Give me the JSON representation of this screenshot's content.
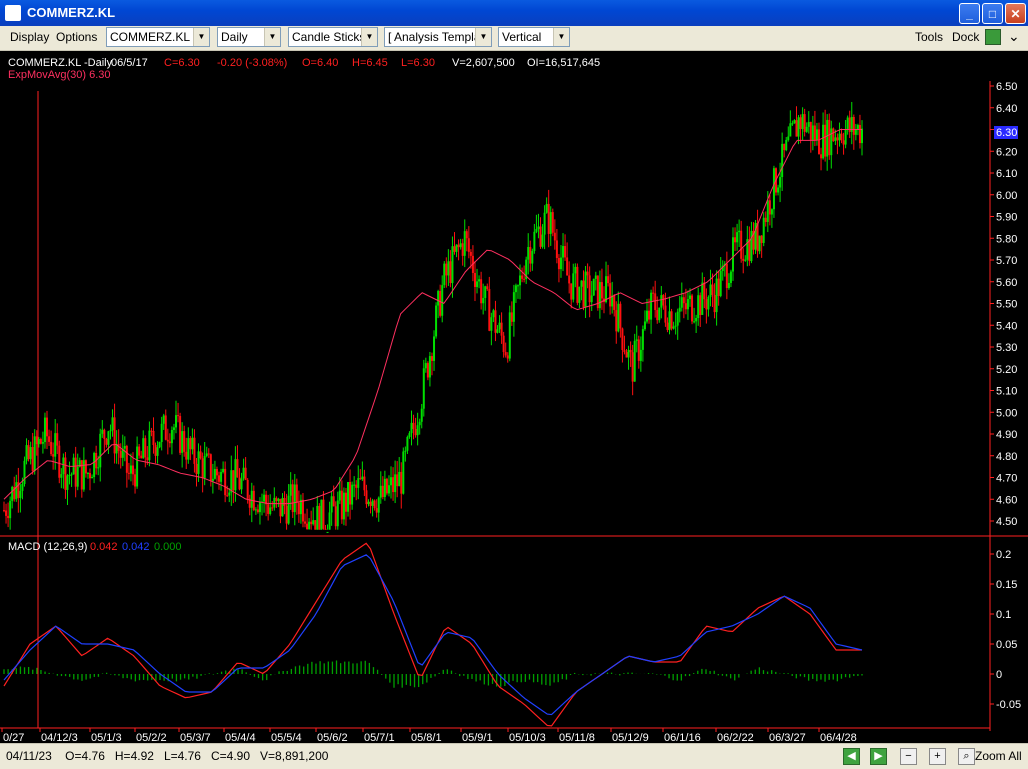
{
  "window": {
    "title": "COMMERZ.KL"
  },
  "menu": {
    "display": "Display",
    "options": "Options",
    "tools": "Tools",
    "dock": "Dock"
  },
  "combos": {
    "symbol": "COMMERZ.KL",
    "period": "Daily",
    "chart_type": "Candle Sticks",
    "template": "[ Analysis Templa",
    "layout": "Vertical"
  },
  "price_pane": {
    "header": {
      "symbol": "COMMERZ.KL -Daily",
      "date": "06/5/17",
      "close": "C=6.30",
      "change": "-0.20 (-3.08%)",
      "open": "O=6.40",
      "high": "H=6.45",
      "low": "L=6.30",
      "volume": "V=2,607,500",
      "oi": "OI=16,517,645"
    },
    "ema_label": "ExpMovAvg(30) 6.30",
    "y_ticks": [
      "6.50",
      "6.40",
      "6.30",
      "6.20",
      "6.10",
      "6.00",
      "5.90",
      "5.80",
      "5.70",
      "5.60",
      "5.50",
      "5.40",
      "5.30",
      "5.20",
      "5.10",
      "5.00",
      "4.90",
      "4.80",
      "4.70",
      "4.60",
      "4.50"
    ],
    "last_price_label": "6.30"
  },
  "macd_pane": {
    "label": "MACD (12,26,9)",
    "v1": "0.042",
    "v2": "0.042",
    "v3": "0.000",
    "y_ticks": [
      "0.2",
      "0.15",
      "0.1",
      "0.05",
      "0",
      "-0.05"
    ]
  },
  "x_ticks": [
    "0/27",
    "04/12/3",
    "05/1/3",
    "05/2/2",
    "05/3/7",
    "05/4/4",
    "05/5/4",
    "05/6/2",
    "05/7/1",
    "05/8/1",
    "05/9/1",
    "05/10/3",
    "05/11/8",
    "05/12/9",
    "06/1/16",
    "06/2/22",
    "06/3/27",
    "06/4/28"
  ],
  "status": {
    "date": "04/11/23",
    "open": "O=4.76",
    "high": "H=4.92",
    "low": "L=4.76",
    "close": "C=4.90",
    "volume": "V=8,891,200",
    "zoom_all": "Zoom All"
  },
  "colors": {
    "up": "#00e000",
    "down": "#ff1010",
    "ema": "#ff3060",
    "macd": "#ff2020",
    "signal": "#2040ff",
    "hist": "#00a000",
    "crosshair": "#ff2020"
  },
  "chart_data": [
    {
      "type": "candlestick",
      "title": "COMMERZ.KL -Daily",
      "ylim": [
        4.45,
        6.55
      ],
      "x_range": [
        "2004-01-27",
        "2006-06-05"
      ],
      "y_scale": "linear",
      "grid": false,
      "series": [
        {
          "name": "Price",
          "values": [
            4.55,
            4.75,
            4.9,
            4.72,
            4.72,
            4.95,
            4.7,
            4.85,
            4.95,
            4.8,
            4.72,
            4.7,
            4.62,
            4.55,
            4.6,
            4.5,
            4.55,
            4.66,
            4.6,
            4.7,
            5.1,
            5.6,
            5.8,
            5.5,
            5.3,
            5.75,
            5.9,
            5.6,
            5.55,
            5.55,
            5.2,
            5.5,
            5.45,
            5.5,
            5.55,
            5.75,
            5.8,
            6.1,
            6.35,
            6.25,
            6.3,
            6.3
          ]
        },
        {
          "name": "ExpMovAvg(30)",
          "values": [
            4.6,
            4.7,
            4.78,
            4.75,
            4.76,
            4.86,
            4.78,
            4.76,
            4.72,
            4.7,
            4.66,
            4.6,
            4.58,
            4.58,
            4.6,
            4.64,
            4.8,
            5.1,
            5.45,
            5.55,
            5.5,
            5.65,
            5.75,
            5.7,
            5.6,
            5.55,
            5.47,
            5.5,
            5.55,
            5.5,
            5.52,
            5.55,
            5.6,
            5.7,
            5.8,
            6.05,
            6.25,
            6.25,
            6.3,
            6.3
          ]
        }
      ]
    },
    {
      "type": "line",
      "title": "MACD (12,26,9)",
      "ylim": [
        -0.09,
        0.23
      ],
      "series": [
        {
          "name": "MACD",
          "values": [
            -0.02,
            0.05,
            0.08,
            0.03,
            0.06,
            0.03,
            -0.02,
            -0.04,
            -0.03,
            0.02,
            0.0,
            0.05,
            0.12,
            0.19,
            0.22,
            0.1,
            -0.01,
            0.08,
            0.05,
            -0.02,
            -0.05,
            -0.09,
            -0.03,
            0.0,
            0.03,
            0.02,
            0.02,
            0.08,
            0.07,
            0.11,
            0.13,
            0.1,
            0.04,
            0.04
          ]
        },
        {
          "name": "Signal",
          "values": [
            -0.01,
            0.04,
            0.08,
            0.05,
            0.05,
            0.04,
            0.0,
            -0.03,
            -0.03,
            0.01,
            0.01,
            0.04,
            0.1,
            0.18,
            0.2,
            0.12,
            0.01,
            0.07,
            0.06,
            0.0,
            -0.04,
            -0.07,
            -0.03,
            0.0,
            0.03,
            0.02,
            0.03,
            0.07,
            0.08,
            0.1,
            0.13,
            0.11,
            0.05,
            0.04
          ]
        },
        {
          "name": "Histogram",
          "values": [
            0.01,
            0.01,
            0.0,
            -0.01,
            0.0,
            -0.01,
            -0.01,
            -0.01,
            0.0,
            0.01,
            -0.01,
            0.01,
            0.02,
            0.02,
            0.02,
            -0.02,
            -0.02,
            0.01,
            -0.01,
            -0.02,
            -0.01,
            -0.02,
            0.0,
            0.0,
            0.0,
            0.0,
            -0.01,
            0.01,
            -0.01,
            0.01,
            0.0,
            -0.01,
            -0.01,
            0.0
          ]
        }
      ]
    }
  ]
}
